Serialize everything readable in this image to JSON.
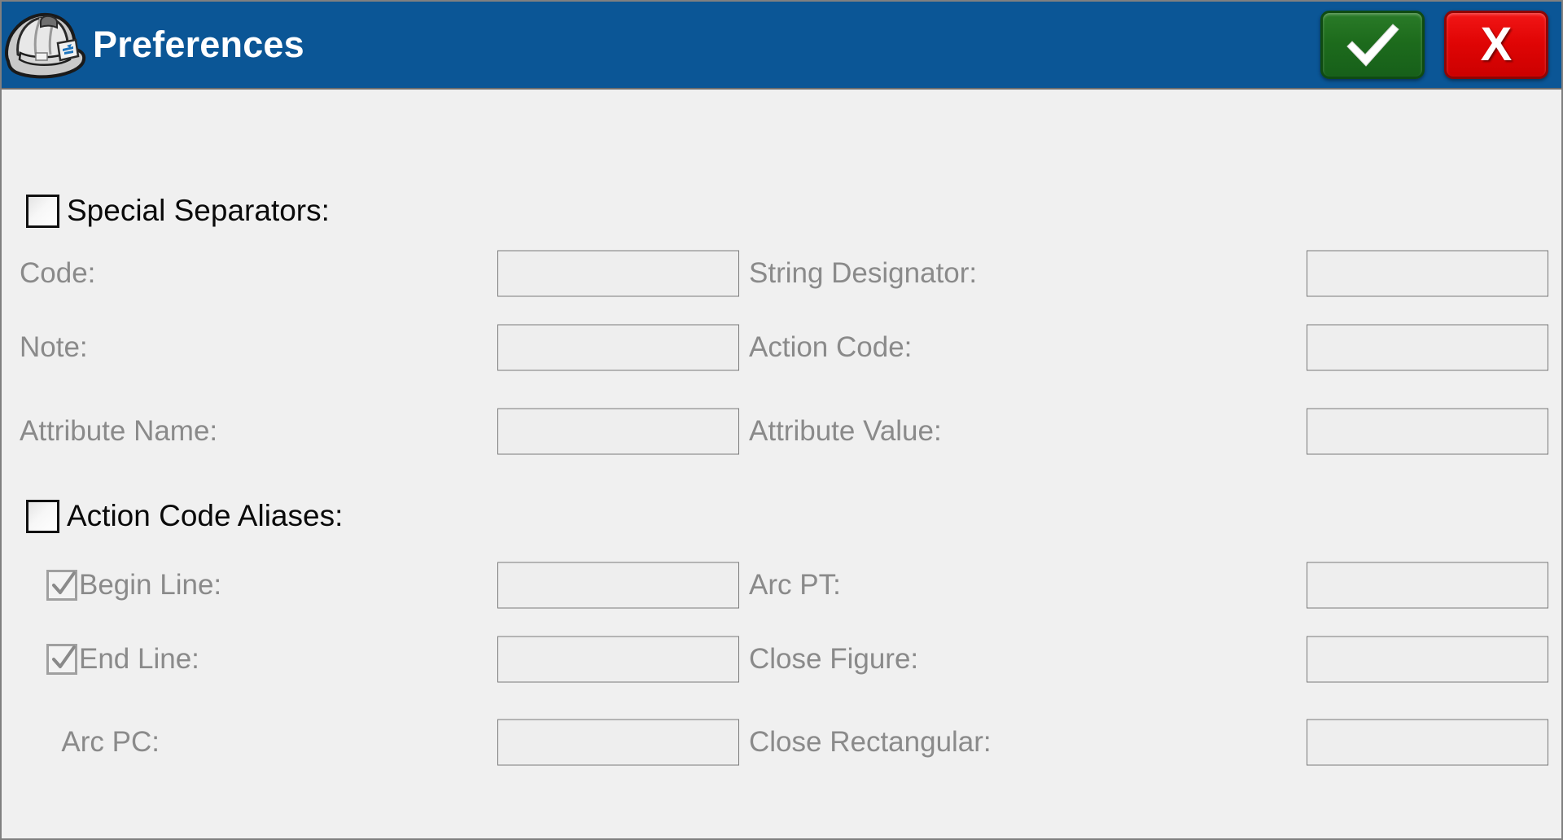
{
  "window": {
    "title": "Preferences",
    "icon": "hard-hat-icon",
    "titlebar_color": "#0b5696",
    "body_color": "#f0f0f0"
  },
  "titlebar_buttons": {
    "accept": {
      "label": "✓",
      "name": "accept-button",
      "color": "#1d6b1c"
    },
    "cancel": {
      "label": "X",
      "name": "cancel-button",
      "color": "#e00505"
    }
  },
  "sections": [
    {
      "id": "special-separators",
      "label": "Special Separators:",
      "checked": false,
      "rows": [
        {
          "left_label": "Code:",
          "left_checkbox": null,
          "left_value": "",
          "mid_label": "String Designator:",
          "right_value": "",
          "disabled": true
        },
        {
          "left_label": "Note:",
          "left_checkbox": null,
          "left_value": "",
          "mid_label": "Action Code:",
          "right_value": "",
          "disabled": true
        },
        {
          "left_label": "Attribute Name:",
          "left_checkbox": null,
          "left_value": "",
          "mid_label": "Attribute Value:",
          "right_value": "",
          "disabled": true
        }
      ]
    },
    {
      "id": "action-code-aliases",
      "label": "Action Code Aliases:",
      "checked": false,
      "rows": [
        {
          "left_label": "Begin Line:",
          "left_checkbox": true,
          "left_value": "",
          "mid_label": "Arc PT:",
          "right_value": "",
          "disabled": true
        },
        {
          "left_label": "End Line:",
          "left_checkbox": true,
          "left_value": "",
          "mid_label": "Close Figure:",
          "right_value": "",
          "disabled": true
        },
        {
          "left_label": "Arc PC:",
          "left_checkbox": null,
          "left_value": "",
          "mid_label": "Close Rectangular:",
          "right_value": "",
          "disabled": true
        }
      ]
    }
  ],
  "placeholders": {
    "empty": ""
  }
}
